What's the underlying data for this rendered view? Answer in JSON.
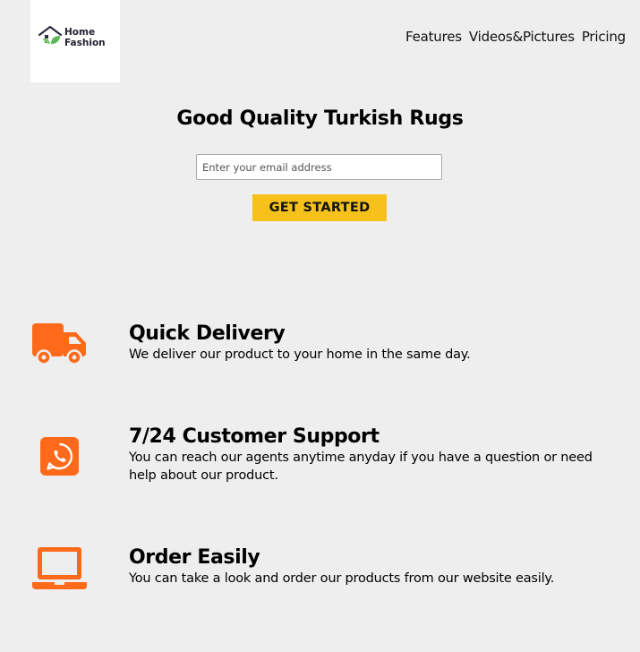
{
  "brand": {
    "line1": "Home",
    "line2": "Fashion"
  },
  "nav": {
    "features": "Features",
    "videos": "Videos&Pictures",
    "pricing": "Pricing"
  },
  "hero": {
    "title": "Good Quality Turkish Rugs",
    "email_placeholder": "Enter your email address",
    "cta_label": "GET STARTED"
  },
  "features": [
    {
      "icon": "truck-icon",
      "title": "Quick Delivery",
      "description": "We deliver our product to your home in the same day."
    },
    {
      "icon": "whatsapp-icon",
      "title": "7/24 Customer Support",
      "description": "You can reach our agents anytime anyday if you have a question or need help about our product."
    },
    {
      "icon": "laptop-icon",
      "title": "Order Easily",
      "description": "You can take a look and order our products from our website easily."
    }
  ],
  "colors": {
    "background": "#eeeeee",
    "accent": "#f5c11a",
    "icon": "#ff6a1a",
    "logo_leaf": "#5cb85c"
  }
}
